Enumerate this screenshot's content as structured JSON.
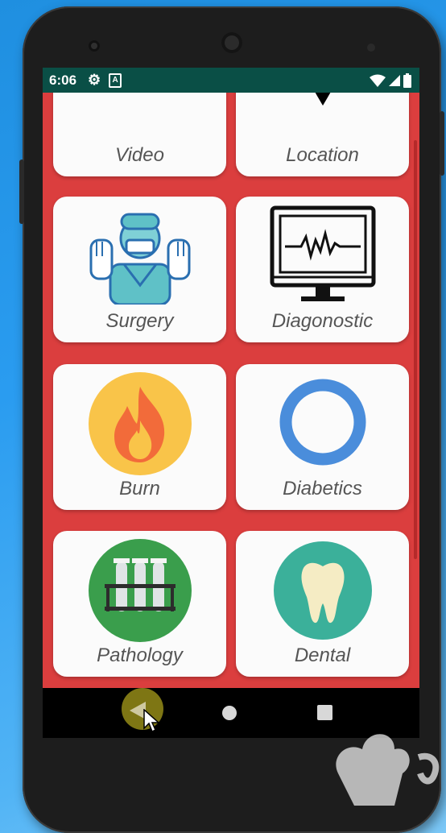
{
  "status_bar": {
    "time": "6:06",
    "gear_icon": "gear-icon",
    "a_icon": "A"
  },
  "tiles": [
    {
      "label": "Video",
      "icon": "video-icon"
    },
    {
      "label": "Location",
      "icon": "location-pin-icon"
    },
    {
      "label": "Surgery",
      "icon": "surgeon-icon"
    },
    {
      "label": "Diagonostic",
      "icon": "monitor-heartbeat-icon"
    },
    {
      "label": "Burn",
      "icon": "flame-icon"
    },
    {
      "label": "Diabetics",
      "icon": "ring-icon"
    },
    {
      "label": "Pathology",
      "icon": "test-tubes-icon"
    },
    {
      "label": "Dental",
      "icon": "tooth-icon"
    }
  ],
  "colors": {
    "background": "#db3e3e",
    "status_bar": "#0a4f46",
    "card": "#fbfbfb"
  }
}
